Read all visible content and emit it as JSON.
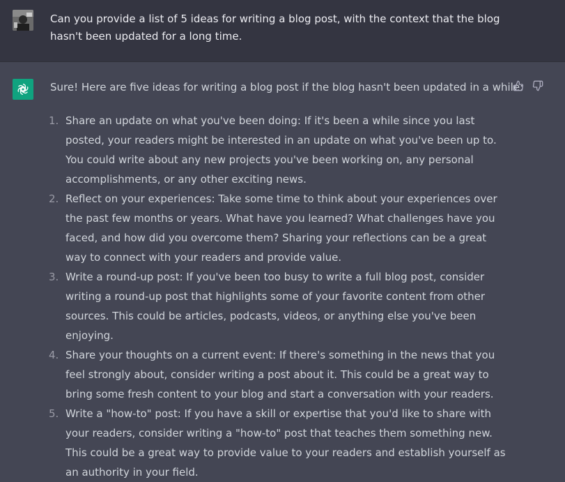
{
  "user_message": {
    "text": "Can you provide a list of 5 ideas for writing a blog post, with the context that the blog hasn't been updated for a long time."
  },
  "assistant_message": {
    "intro": "Sure! Here are five ideas for writing a blog post if the blog hasn't been updated in a while:",
    "items": [
      {
        "num": "1.",
        "text": "Share an update on what you've been doing: If it's been a while since you last posted, your readers might be interested in an update on what you've been up to. You could write about any new projects you've been working on, any personal accomplishments, or any other exciting news."
      },
      {
        "num": "2.",
        "text": "Reflect on your experiences: Take some time to think about your experiences over the past few months or years. What have you learned? What challenges have you faced, and how did you overcome them? Sharing your reflections can be a great way to connect with your readers and provide value."
      },
      {
        "num": "3.",
        "text": "Write a round-up post: If you've been too busy to write a full blog post, consider writing a round-up post that highlights some of your favorite content from other sources. This could be articles, podcasts, videos, or anything else you've been enjoying."
      },
      {
        "num": "4.",
        "text": "Share your thoughts on a current event: If there's something in the news that you feel strongly about, consider writing a post about it. This could be a great way to bring some fresh content to your blog and start a conversation with your readers."
      },
      {
        "num": "5.",
        "text": "Write a \"how-to\" post: If you have a skill or expertise that you'd like to share with your readers, consider writing a \"how-to\" post that teaches them something new. This could be a great way to provide value to your readers and establish yourself as an authority in your field."
      }
    ]
  },
  "icons": {
    "user_avatar": "user-avatar",
    "bot_avatar": "openai-logo-icon",
    "thumbs_up": "thumbs-up-icon",
    "thumbs_down": "thumbs-down-icon"
  },
  "colors": {
    "user_bg": "#343541",
    "assistant_bg": "#444654",
    "brand": "#10a37f",
    "text": "#d1d5db"
  }
}
